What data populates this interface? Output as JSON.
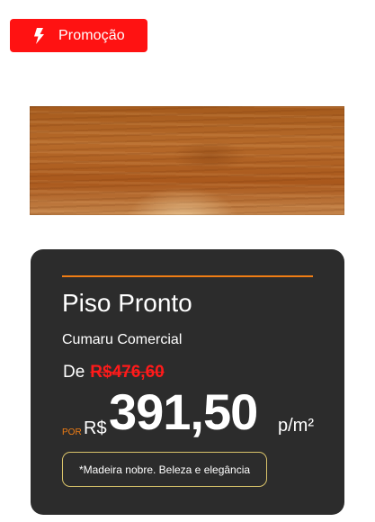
{
  "promo": {
    "label": "Promoção",
    "icon": "lightning-bolt-icon",
    "background_color": "#ff1212"
  },
  "product": {
    "image": "wood-plank-image",
    "title": "Piso Pronto",
    "subtitle": "Cumaru Comercial",
    "old_price_label": "De",
    "old_price": "R$476,60",
    "price_prefix": "POR",
    "currency": "R$",
    "price": "391,50",
    "price_unit": "p/m²",
    "note": "*Madeira nobre. Beleza e elegância"
  },
  "colors": {
    "card_background": "#2c2c2c",
    "accent_orange": "#f07d14",
    "old_price_red": "#ff1a1a",
    "note_border": "#d9c36a"
  }
}
